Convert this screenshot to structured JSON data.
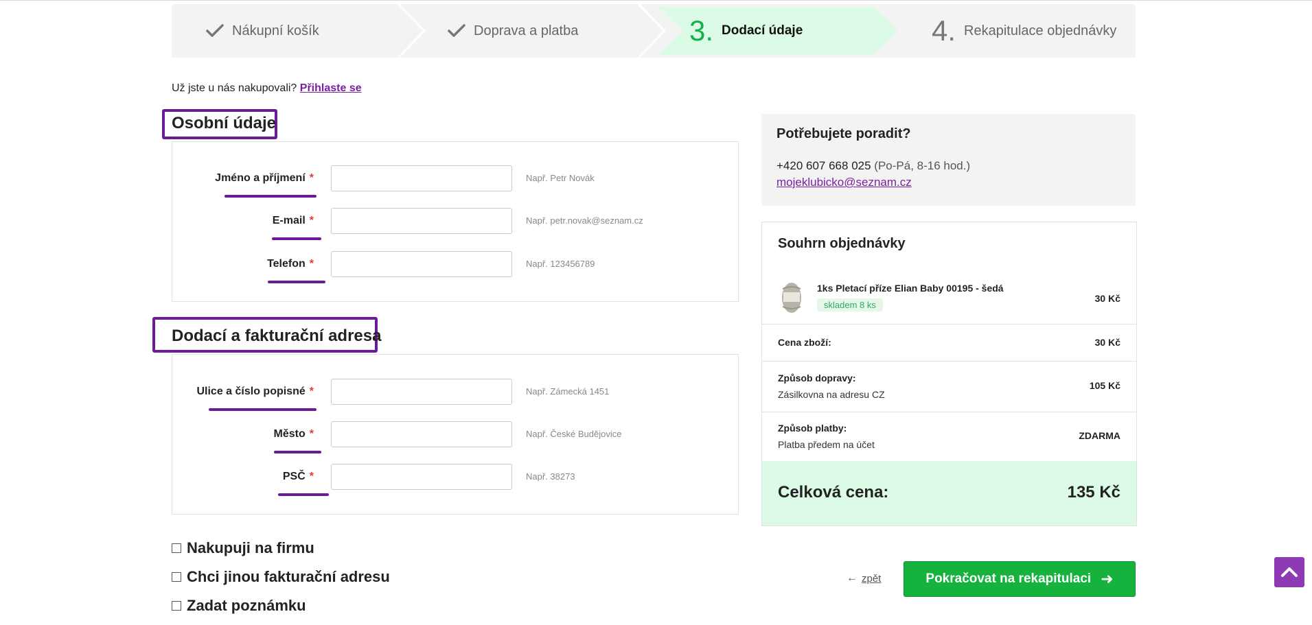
{
  "steps": [
    {
      "label": "Nákupní košík",
      "state": "done",
      "icon": "check-icon"
    },
    {
      "label": "Doprava a platba",
      "state": "done",
      "icon": "check-icon"
    },
    {
      "num": "3.",
      "label": "Dodací údaje",
      "state": "active"
    },
    {
      "num": "4.",
      "label": "Rekapitulace objednávky",
      "state": "pending"
    }
  ],
  "login": {
    "question": "Už jste u nás nakupovali?",
    "link": "Přihlaste se"
  },
  "personal": {
    "title": "Osobní údaje",
    "fields": [
      {
        "label": "Jméno a příjmení",
        "required": "*",
        "value": "",
        "placeholder": "",
        "hint": "Např. Petr Novák"
      },
      {
        "label": "E-mail",
        "required": "*",
        "value": "",
        "placeholder": "",
        "hint": "Např. petr.novak@seznam.cz"
      },
      {
        "label": "Telefon",
        "required": "*",
        "value": "",
        "placeholder": "",
        "hint": "Např. 123456789"
      }
    ]
  },
  "address": {
    "title": "Dodací a fakturační adresa",
    "fields": [
      {
        "label": "Ulice a číslo popisné",
        "required": "*",
        "value": "",
        "placeholder": "",
        "hint": "Např. Zámecká 1451"
      },
      {
        "label": "Město",
        "required": "*",
        "value": "",
        "placeholder": "",
        "hint": "Např. České Budějovice"
      },
      {
        "label": "PSČ",
        "required": "*",
        "value": "",
        "placeholder": "",
        "hint": "Např. 38273"
      }
    ]
  },
  "options": [
    {
      "label": "Nakupuji na firmu",
      "checked": false
    },
    {
      "label": "Chci jinou fakturační adresu",
      "checked": false
    },
    {
      "label": "Zadat poznámku",
      "checked": false
    }
  ],
  "help": {
    "title": "Potřebujete poradit?",
    "phone": "+420 607 668 025",
    "hours": "(Po-Pá, 8-16 hod.)",
    "email": "mojeklubicko@seznam.cz"
  },
  "summary": {
    "title": "Souhrn objednávky",
    "item": {
      "name": "1ks Pletací příze Elian Baby 00195 - šedá",
      "stock": "skladem 8 ks",
      "price": "30 Kč"
    },
    "goods": {
      "label": "Cena zboží:",
      "value": "30 Kč"
    },
    "shipping": {
      "label": "Způsob dopravy:",
      "detail": "Zásilkovna na adresu CZ",
      "value": "105 Kč"
    },
    "payment": {
      "label": "Způsob platby:",
      "detail": "Platba předem na účet",
      "value": "ZDARMA"
    },
    "total": {
      "label": "Celková cena:",
      "value": "135 Kč"
    }
  },
  "actions": {
    "back": "zpět",
    "continue": "Pokračovat na rekapitulaci"
  },
  "colors": {
    "accent": "#7a1fa2",
    "annotation": "#6a1b9a",
    "green": "#15b33d",
    "active_step": "#dcfbe6",
    "required": "#e53935"
  }
}
